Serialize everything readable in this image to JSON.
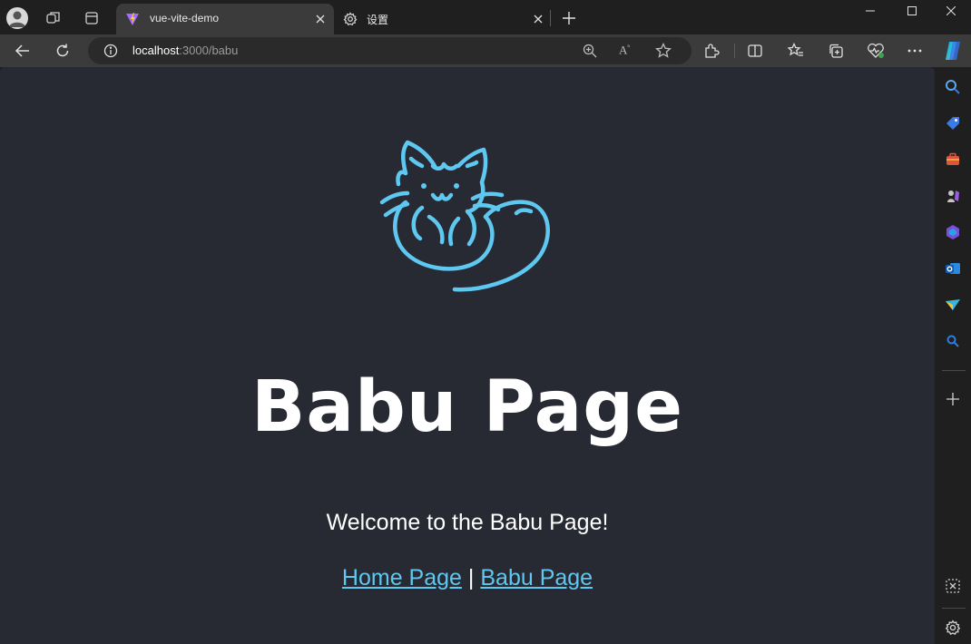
{
  "browser": {
    "tabs": [
      {
        "title": "vue-vite-demo",
        "active": true,
        "icon": "vite-logo-icon"
      },
      {
        "title": "设置",
        "active": false,
        "icon": "gear-icon"
      }
    ],
    "address": {
      "host": "localhost",
      "rest": ":3000/babu"
    }
  },
  "page": {
    "heading": "Babu Page",
    "welcome": "Welcome to the Babu Page!",
    "links": {
      "home": "Home Page",
      "separator": "|",
      "babu": "Babu Page"
    }
  },
  "colors": {
    "accent": "#5ec8f0",
    "page_bg": "#282a33",
    "chrome_bg": "#1f1f1f",
    "toolbar_bg": "#3b3b3b"
  }
}
